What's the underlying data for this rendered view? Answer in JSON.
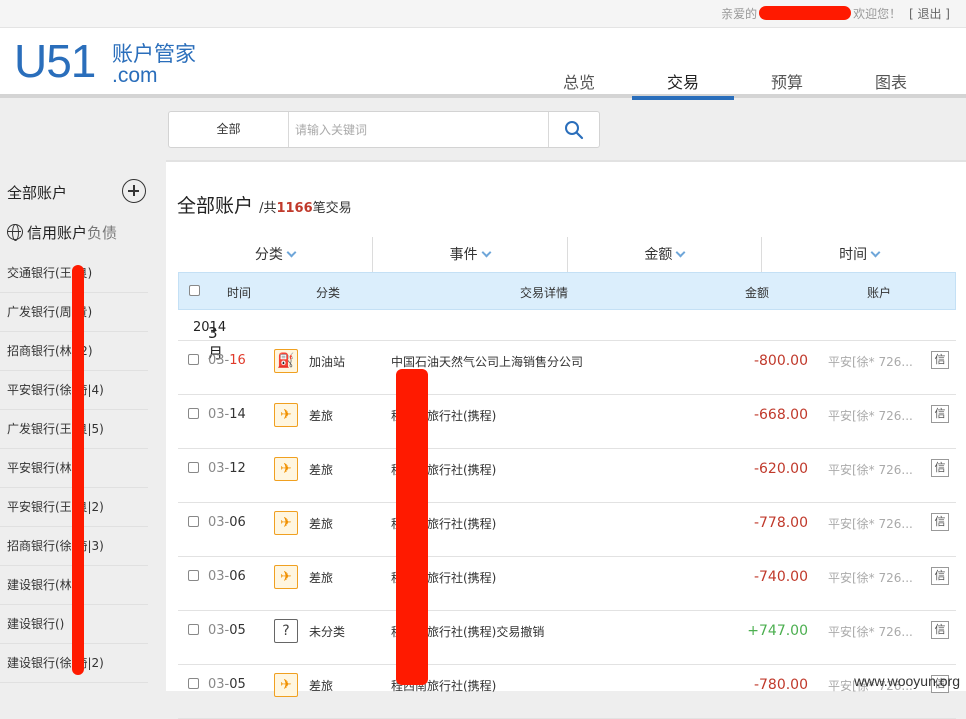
{
  "topbar": {
    "greeting_prefix": "亲爱的",
    "greeting_suffix": "欢迎您！",
    "logout": "[ 退出 ]"
  },
  "logo": {
    "mark": "U51",
    "name_cn": "账户管家",
    "domain": ".com"
  },
  "nav": {
    "tabs": [
      "总览",
      "交易",
      "预算",
      "图表"
    ],
    "active": "交易"
  },
  "search": {
    "scope": "全部",
    "placeholder": "请输入关键词",
    "icon": "search-icon"
  },
  "sidebar": {
    "title": "全部账户",
    "section": "信用账户",
    "section_suffix": "负债",
    "items": [
      "交通银行(王  良)",
      "广发银行(周  贵)",
      "招商银行(林  )2)",
      "平安银行(徐  琦|4)",
      "广发银行(王  良|5)",
      "平安银行(林  )",
      "平安银行(王  良|2)",
      "招商银行(徐  琦|3)",
      "建设银行(林  )",
      "建设银行()",
      "建设银行(徐  琦|2)"
    ]
  },
  "main": {
    "title": "全部账户",
    "sub_prefix": "/共",
    "count": "1166",
    "sub_suffix": "笔交易",
    "filters": [
      "分类",
      "事件",
      "金额",
      "时间"
    ],
    "columns": [
      "时间",
      "分类",
      "交易详情",
      "金额",
      "账户"
    ],
    "month": "3月",
    "year": "2014",
    "rows": [
      {
        "month": "03-",
        "day": "16",
        "category": "加油站",
        "icon": "gas-station-icon",
        "detail": "中国石油天然气公司上海销售分公司",
        "amount": "-800.00",
        "account": "平安[徐*  726...",
        "tag": "信"
      },
      {
        "month": "03-",
        "day": "14",
        "category": "差旅",
        "icon": "airplane-icon",
        "detail": "程西南旅行社(携程)",
        "amount": "-668.00",
        "account": "平安[徐*  726...",
        "tag": "信"
      },
      {
        "month": "03-",
        "day": "12",
        "category": "差旅",
        "icon": "airplane-icon",
        "detail": "程西南旅行社(携程)",
        "amount": "-620.00",
        "account": "平安[徐*  726...",
        "tag": "信"
      },
      {
        "month": "03-",
        "day": "06",
        "category": "差旅",
        "icon": "airplane-icon",
        "detail": "程西南旅行社(携程)",
        "amount": "-778.00",
        "account": "平安[徐*  726...",
        "tag": "信"
      },
      {
        "month": "03-",
        "day": "06",
        "category": "差旅",
        "icon": "airplane-icon",
        "detail": "程西南旅行社(携程)",
        "amount": "-740.00",
        "account": "平安[徐*  726...",
        "tag": "信"
      },
      {
        "month": "03-",
        "day": "05",
        "category": "未分类",
        "icon": "question-icon",
        "detail": "程西南旅行社(携程)交易撤销",
        "amount": "+747.00",
        "account": "平安[徐*  726...",
        "tag": "信"
      },
      {
        "month": "03-",
        "day": "05",
        "category": "差旅",
        "icon": "airplane-icon",
        "detail": "程西南旅行社(携程)",
        "amount": "-780.00",
        "account": "平安[徐*  726...",
        "tag": "信"
      }
    ]
  },
  "watermark": "www.wooyun.org"
}
